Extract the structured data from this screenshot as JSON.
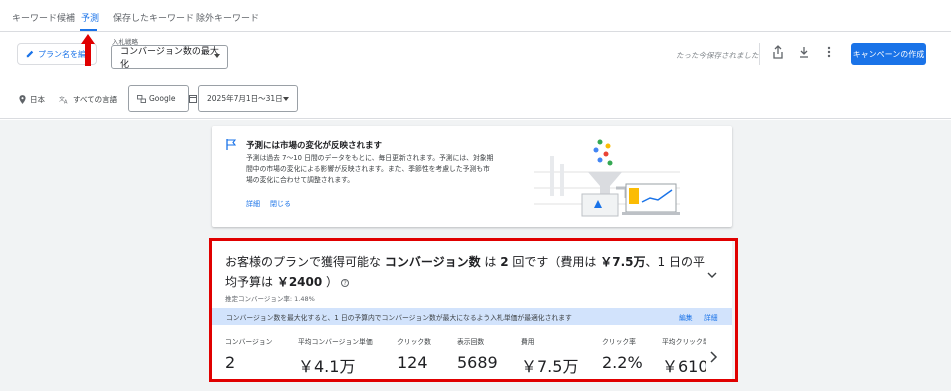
{
  "tabs": [
    "キーワード候補",
    "予測",
    "保存したキーワード",
    "除外キーワード"
  ],
  "toolbar": {
    "rename_label": "プラン名を編",
    "bid_label": "入札戦略",
    "bid_value": "コンバージョン数の最大化",
    "saved_text": "たった今保存されました",
    "create_label": "キャンペーンの作成"
  },
  "filters": {
    "location": "日本",
    "language": "すべての言語",
    "network": "Google",
    "date_range": "2025年7月1日〜31日"
  },
  "info_card": {
    "title": "予測には市場の変化が反映されます",
    "body": "予測は過去 7〜10 日間のデータをもとに、毎日更新されます。予測には、対象期間中の市場の変化による影響が反映されます。また、季節性を考慮した予測も市場の変化に合わせて調整されます。",
    "link_details": "詳細",
    "link_close": "閉じる"
  },
  "forecast": {
    "h_part1": "お客様のプランで獲得可能な ",
    "h_metric": "コンバージョン数",
    "h_part2": " は ",
    "h_count": "2",
    "h_part3": " 回です（費用は ",
    "h_cost": "￥7.5万",
    "h_part4": "、1 日の平均予算は ",
    "h_budget": "￥2400",
    "h_part5": " ）",
    "sub": "推定コンバージョン率: 1.48%",
    "banner": "コンバージョン数を最大化すると、1 日の予算内でコンバージョン数が最大になるよう入札単価が最適化されます",
    "banner_edit": "編集",
    "banner_details": "詳細",
    "metrics": [
      {
        "label": "コンバージョン",
        "value": "2"
      },
      {
        "label": "平均コンバージョン単価",
        "value": "￥4.1万"
      },
      {
        "label": "クリック数",
        "value": "124"
      },
      {
        "label": "表示回数",
        "value": "5689"
      },
      {
        "label": "費用",
        "value": "￥7.5万"
      },
      {
        "label": "クリック率",
        "value": "2.2%"
      },
      {
        "label": "平均クリック単価",
        "value": "￥610"
      }
    ]
  },
  "colors": {
    "accent": "#1a73e8",
    "highlight_red": "#e00000",
    "banner": "#d2e3fc"
  }
}
